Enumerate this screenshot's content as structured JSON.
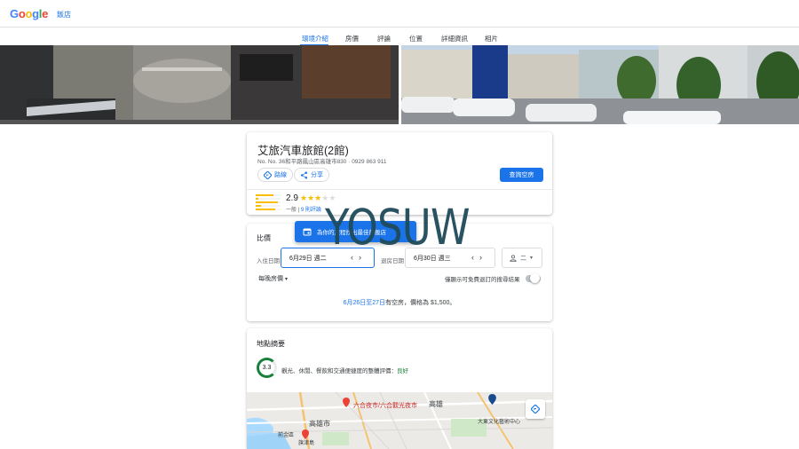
{
  "header": {
    "logo_letters": [
      "G",
      "o",
      "o",
      "g",
      "l",
      "e"
    ],
    "section": "飯店"
  },
  "tabs": [
    {
      "label": "環境介紹",
      "active": true
    },
    {
      "label": "房價",
      "active": false
    },
    {
      "label": "評論",
      "active": false
    },
    {
      "label": "位置",
      "active": false
    },
    {
      "label": "詳細資訊",
      "active": false
    },
    {
      "label": "相片",
      "active": false
    }
  ],
  "hotel": {
    "name": "艾旅汽車旅館(2館)",
    "address": "No. No. 36和平路鳳山區高雄市830 · 0929 863 911",
    "directions_label": "路線",
    "share_label": "分享",
    "check_availability_label": "查詢空房",
    "rating": "2.9",
    "stars_filled": 3,
    "stars_total": 5,
    "rating_category": "一般",
    "review_count": "9 則評論",
    "rating_bar_fractions": [
      0.7,
      0.1,
      0.9,
      0.2,
      0.8
    ]
  },
  "prices": {
    "title": "比價",
    "promo_text": "為你的旅程找出最佳的飯店",
    "checkin_label": "入住日期",
    "checkin_value": "6月29日 週二",
    "checkout_label": "退房日期",
    "checkout_value": "6月30日 週三",
    "guests_value": "二",
    "nightly_label": "每晚房價",
    "free_cancel_label": "僅顯示可免費退訂的搜尋結果",
    "avail_range": "6月26日至27日",
    "avail_rest": "有空房，價格為 $1,500。"
  },
  "location": {
    "title": "地點摘要",
    "score": "3.3",
    "score_text": "觀光、休閒、餐飲和交通便捷度的整體評價：",
    "score_verdict": "良好",
    "map_labels": [
      "高雄",
      "高雄市",
      "六合夜市/六合觀光夜市",
      "大東文化藝術中心",
      "旗津島",
      "前金區"
    ]
  },
  "watermark": "YOSUW",
  "colors": {
    "accent": "#1a73e8",
    "star": "#fbbc04",
    "good": "#188038"
  }
}
